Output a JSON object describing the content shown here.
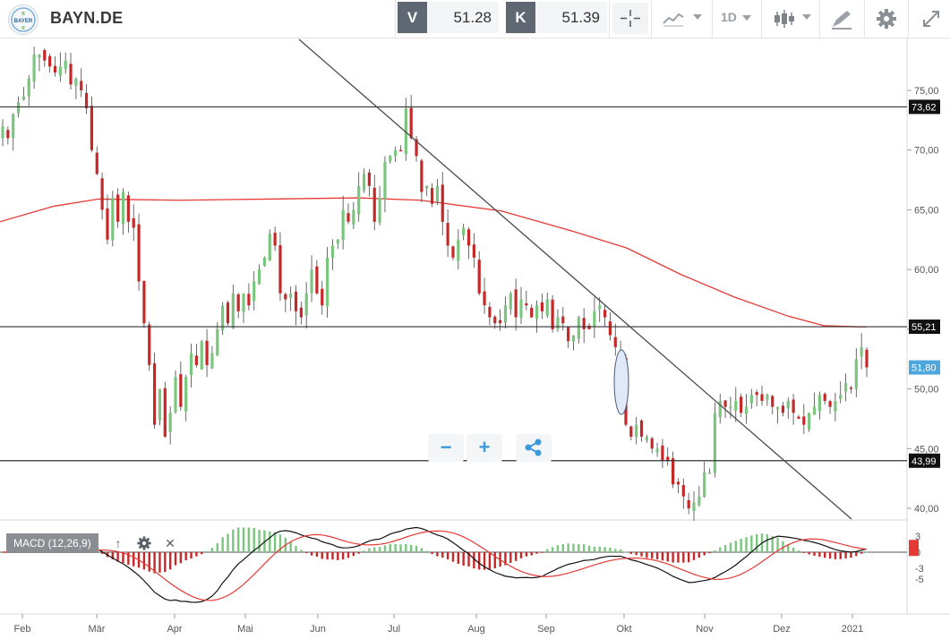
{
  "header": {
    "symbol": "BAYN.DE",
    "bid_label": "V",
    "bid_value": "51.28",
    "ask_label": "K",
    "ask_value": "51.39",
    "interval_label": "1D"
  },
  "logo": {
    "text": "BAYER"
  },
  "price_axis": {
    "ticks": [
      "75,00",
      "70,00",
      "65,00",
      "60,00",
      "55,00",
      "50,00",
      "45,00",
      "40,00"
    ],
    "level_labels": [
      "73,62",
      "55,21",
      "43,99"
    ],
    "last_price_label": "51,80"
  },
  "macd": {
    "label": "MACD (12,26,9)",
    "ticks": [
      "3",
      "0",
      "-3",
      "-5"
    ]
  },
  "time_axis": {
    "months": [
      "Feb",
      "Mär",
      "Apr",
      "Mai",
      "Jun",
      "Jul",
      "Aug",
      "Sep",
      "Okt",
      "Nov",
      "Dez",
      "2021"
    ]
  },
  "colors": {
    "up": "#7bc67e",
    "down": "#c62828",
    "ma200": "#e53935",
    "level_line": "#333333",
    "current_price": "#4da6dc"
  },
  "chart_data": {
    "type": "candlestick",
    "price_ylim": [
      38.5,
      78.5
    ],
    "horizontal_levels": [
      73.62,
      55.21,
      43.99
    ],
    "last_price": 51.8,
    "closes": [
      72,
      71,
      73,
      74,
      74.5,
      76,
      78,
      78,
      77.5,
      77,
      76.5,
      77,
      77.5,
      75.5,
      76,
      75,
      73.5,
      70,
      68,
      65,
      62.5,
      66,
      64,
      66.5,
      64,
      63.5,
      59,
      55.5,
      52,
      47,
      50,
      46,
      48,
      51,
      48.5,
      51,
      53,
      52,
      54,
      52,
      53,
      55,
      57,
      55.5,
      58,
      56.5,
      58,
      57,
      59,
      60,
      61,
      63,
      62,
      58,
      57.5,
      58,
      56.5,
      56,
      58,
      60,
      58,
      57,
      61,
      62,
      62.5,
      65,
      64,
      65,
      67,
      68,
      67,
      64,
      66,
      69,
      69.5,
      70,
      70,
      73.5,
      71,
      69.5,
      66.5,
      67,
      65.5,
      67,
      64,
      62,
      61,
      62.5,
      63.5,
      62,
      61,
      58,
      57,
      56,
      55.5,
      55.5,
      57,
      58,
      56,
      57.5,
      57,
      56,
      57,
      56.5,
      57.5,
      55,
      56,
      55.5,
      54,
      54.5,
      56,
      55,
      55,
      56.5,
      57,
      56,
      54.5,
      53.5,
      53,
      47,
      46,
      47,
      46,
      46,
      45,
      45,
      44,
      44,
      42,
      42,
      41,
      40,
      40.5,
      41,
      43,
      43,
      48,
      49,
      48.5,
      48.5,
      49,
      48,
      48.5,
      49.5,
      49.5,
      49,
      49.5,
      48.5,
      48.5,
      48,
      49,
      48,
      47.5,
      47,
      48,
      48.5,
      49.5,
      49,
      48.5,
      49,
      49.5,
      50.5,
      50,
      52.5,
      53.5,
      51.8
    ]
  }
}
